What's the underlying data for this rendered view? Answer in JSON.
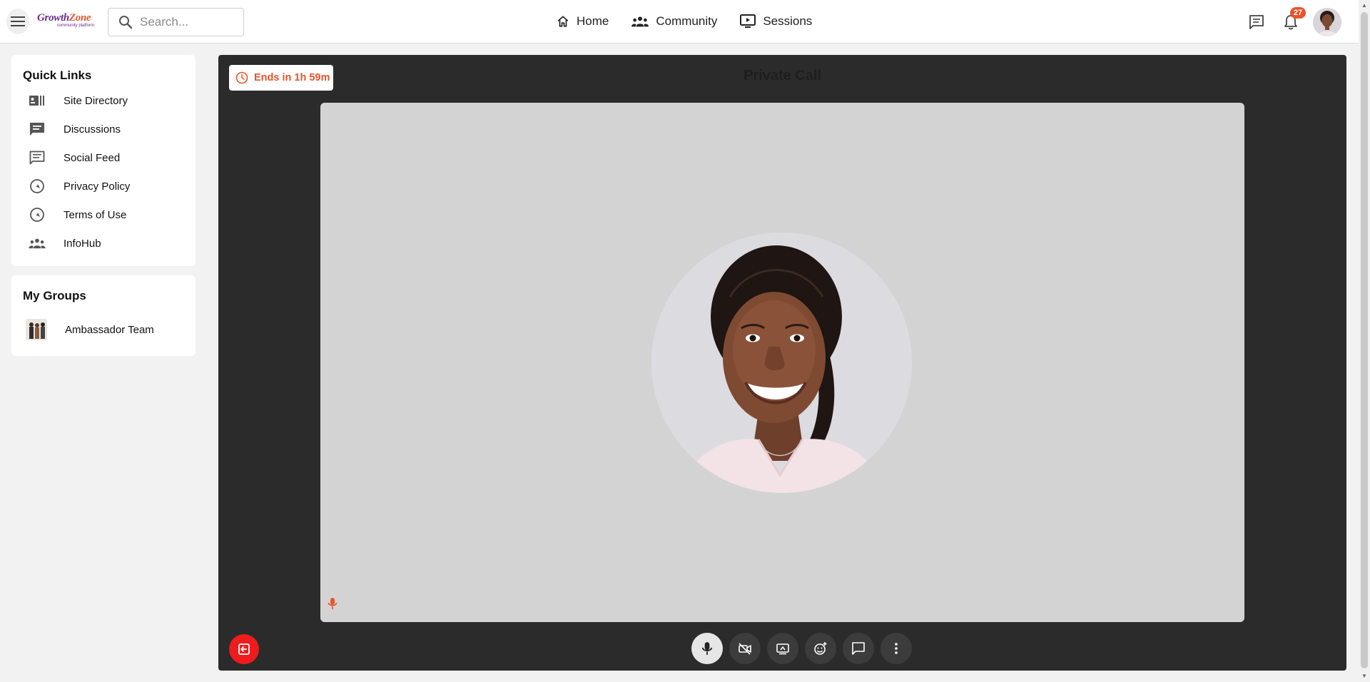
{
  "header": {
    "logo": {
      "brand_main": "Growth",
      "brand_accent": "Zone",
      "tagline": "community platform"
    },
    "search": {
      "placeholder": "Search..."
    },
    "nav": [
      {
        "label": "Home",
        "icon": "home-icon"
      },
      {
        "label": "Community",
        "icon": "community-icon"
      },
      {
        "label": "Sessions",
        "icon": "sessions-icon"
      }
    ],
    "notifications_count": "27"
  },
  "sidebar": {
    "quick_links_title": "Quick Links",
    "quick_links": [
      {
        "label": "Site Directory",
        "icon": "directory-icon"
      },
      {
        "label": "Discussions",
        "icon": "discussion-icon"
      },
      {
        "label": "Social Feed",
        "icon": "feed-icon"
      },
      {
        "label": "Privacy Policy",
        "icon": "wrench-icon"
      },
      {
        "label": "Terms of Use",
        "icon": "wrench-icon"
      },
      {
        "label": "InfoHub",
        "icon": "group-icon"
      }
    ],
    "my_groups_title": "My Groups",
    "groups": [
      {
        "label": "Ambassador Team"
      }
    ]
  },
  "call": {
    "timer": "Ends in 1h 59m",
    "title": "Private Call",
    "controls": [
      "microphone",
      "camera-off",
      "screen-share",
      "reactions",
      "chat",
      "more"
    ]
  },
  "colors": {
    "accent": "#e8542c",
    "brand": "#6b2a8c",
    "panel": "#2b2b2b",
    "leave": "#ee1c1c"
  }
}
